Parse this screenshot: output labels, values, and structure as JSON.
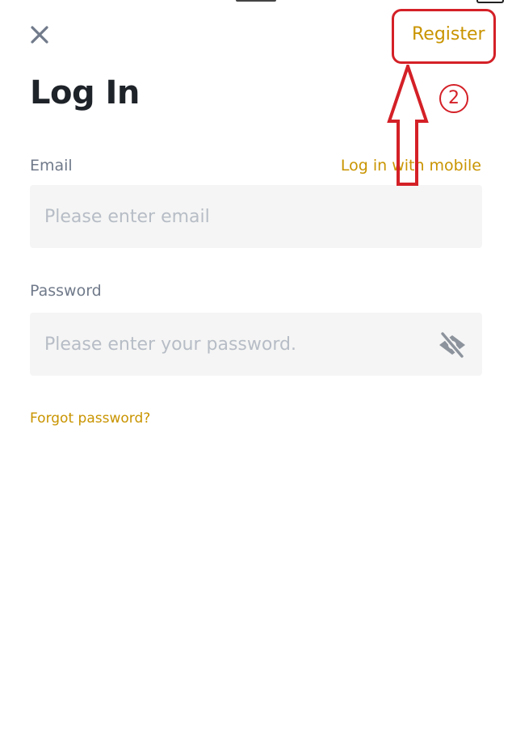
{
  "header": {
    "close_icon": "close-icon",
    "register_label": "Register"
  },
  "page": {
    "title": "Log In"
  },
  "email": {
    "label": "Email",
    "mobile_link": "Log in with mobile",
    "placeholder": "Please enter email",
    "value": ""
  },
  "password": {
    "label": "Password",
    "placeholder": "Please enter your password.",
    "value": "",
    "toggle_icon": "eye-off-icon"
  },
  "forgot_password": "Forgot password?",
  "annotation": {
    "step_number": "2",
    "color": "#d42027"
  },
  "theme": {
    "accent": "#c99400",
    "input_bg": "#f5f5f5",
    "label_color": "#707a8a"
  }
}
